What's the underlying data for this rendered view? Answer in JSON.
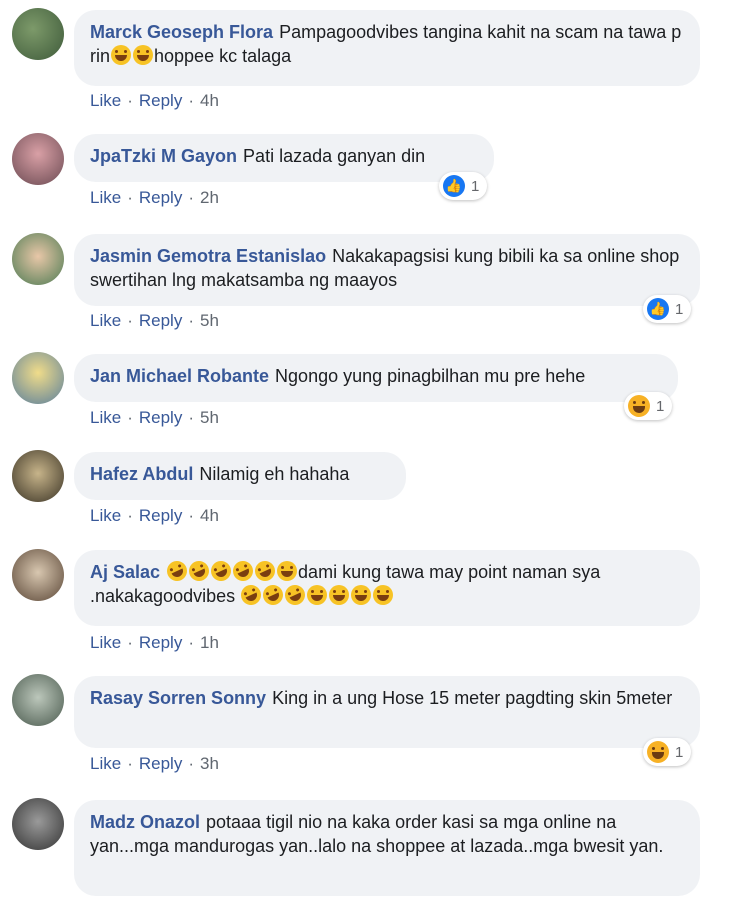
{
  "colors": {
    "name": "#385898",
    "bubble": "#f0f2f5",
    "like": "#1877f2",
    "haha": "#f7b125"
  },
  "actions": {
    "like": "Like",
    "reply": "Reply",
    "dot": "·"
  },
  "comments": [
    {
      "author": "Marck Geoseph Flora",
      "text_a": "Pampagoodvibes tangina kahit na scam na tawa p rin",
      "text_b": "hoppee kc talaga",
      "time": "4h"
    },
    {
      "author": "JpaTzki M Gayon",
      "text": "Pati lazada ganyan din",
      "time": "2h",
      "reaction": {
        "type": "like-icon",
        "count": "1"
      }
    },
    {
      "author": "Jasmin Gemotra Estanislao",
      "text": "Nakakapagsisi kung bibili ka sa online shop swertihan lng makatsamba ng maayos",
      "time": "5h",
      "reaction": {
        "type": "like-icon",
        "count": "1"
      }
    },
    {
      "author": "Jan Michael Robante",
      "text": "Ngongo yung pinagbilhan mu pre hehe",
      "time": "5h",
      "reaction": {
        "type": "haha-icon",
        "count": "1"
      }
    },
    {
      "author": "Hafez Abdul",
      "text": "Nilamig eh hahaha",
      "time": "4h"
    },
    {
      "author": "Aj Salac",
      "text_a": "dami kung tawa may point naman sya .nakakagoodvibes",
      "time": "1h"
    },
    {
      "author": "Rasay Sorren Sonny",
      "text": "King in a ung Hose 15 meter pagdting skin 5meter",
      "time": "3h",
      "reaction": {
        "type": "haha-icon",
        "count": "1"
      }
    },
    {
      "author": "Madz Onazol",
      "text": "potaaa tigil nio na kaka order kasi sa mga online na yan...mga mandurogas yan..lalo na shoppee at lazada..mga bwesit yan."
    }
  ]
}
